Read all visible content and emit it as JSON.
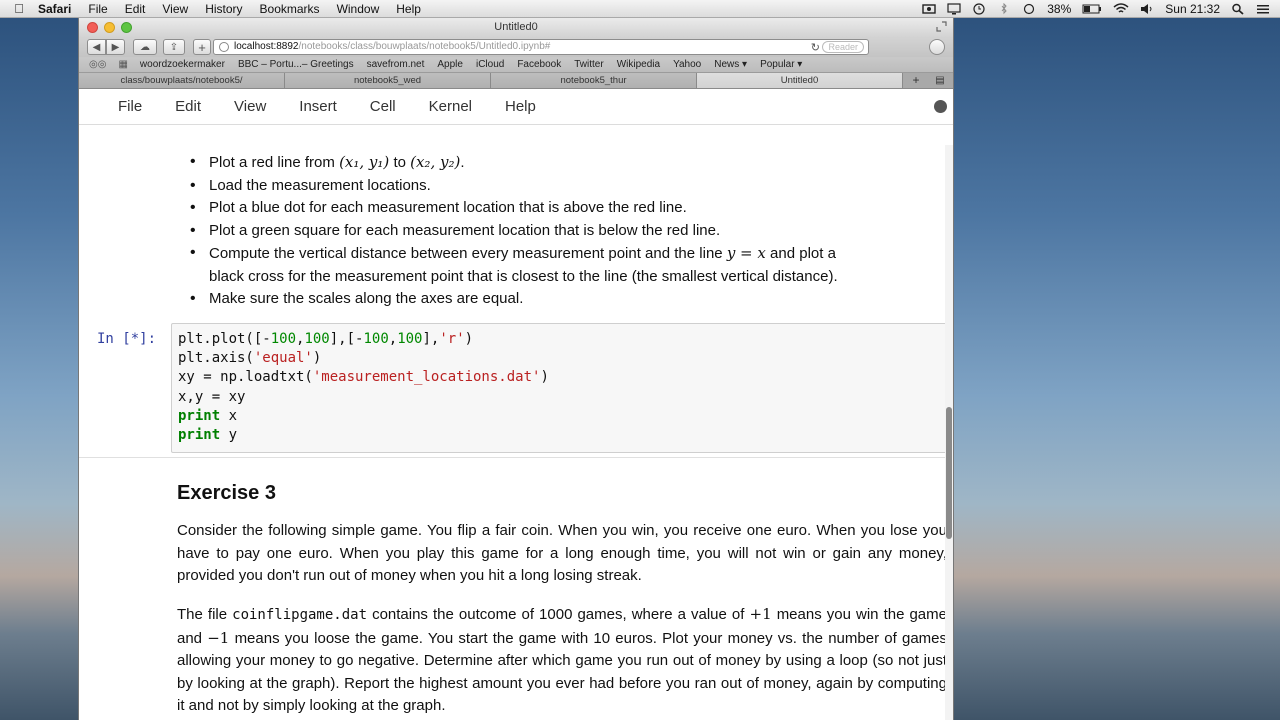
{
  "menubar": {
    "app": "Safari",
    "items": [
      "File",
      "Edit",
      "View",
      "History",
      "Bookmarks",
      "Window",
      "Help"
    ],
    "battery": "38%",
    "clock": "Sun 21:32"
  },
  "window": {
    "title": "Untitled0"
  },
  "toolbar": {
    "url_host": "localhost:8892",
    "url_path": "/notebooks/class/bouwplaats/notebook5/Untitled0.ipynb#",
    "reader": "Reader"
  },
  "bookmarks": [
    "woordzoekermaker",
    "BBC – Portu...– Greetings",
    "savefrom.net",
    "Apple",
    "iCloud",
    "Facebook",
    "Twitter",
    "Wikipedia",
    "Yahoo",
    "News ▾",
    "Popular ▾"
  ],
  "tabs": [
    "class/bouwplaats/notebook5/",
    "notebook5_wed",
    "notebook5_thur",
    "Untitled0"
  ],
  "jupyter_menu": [
    "File",
    "Edit",
    "View",
    "Insert",
    "Cell",
    "Kernel",
    "Help"
  ],
  "markdown1": {
    "b1_pre": "Plot a red line from",
    "b1_m1": "(x₁, y₁)",
    "b1_mid": "to",
    "b1_m2": "(x₂, y₂)",
    "b1_end": ".",
    "b2": "Load the measurement locations.",
    "b3": "Plot a blue dot for each measurement location that is above the red line.",
    "b4": "Plot a green square for each measurement location that is below the red line.",
    "b5_pre": "Compute the vertical distance between every measurement point and the line",
    "b5_math": "y = x",
    "b5_post": "and plot a",
    "b5_line2": "black cross for the measurement point that is closest to the line (the smallest vertical distance).",
    "b6": "Make sure the scales along the axes are equal."
  },
  "code_cell": {
    "prompt": "In [*]:",
    "l1_a": "plt.plot([-",
    "l1_n1": "100",
    "l1_b": ",",
    "l1_n2": "100",
    "l1_c": "],[-",
    "l1_n3": "100",
    "l1_d": ",",
    "l1_n4": "100",
    "l1_e": "],",
    "l1_s": "'r'",
    "l1_f": ")",
    "l2_a": "plt.axis(",
    "l2_s": "'equal'",
    "l2_b": ")",
    "l3_a": "xy = np.loadtxt(",
    "l3_s": "'measurement_locations.dat'",
    "l3_b": ")",
    "l4": "x,y = xy",
    "l5_kw": "print",
    "l5_v": " x",
    "l6_kw": "print",
    "l6_v": " y"
  },
  "exercise": {
    "title": "Exercise 3",
    "p1": "Consider the following simple game. You flip a fair coin. When you win, you receive one euro. When you lose you have to pay one euro. When you play this game for a long enough time, you will not win or gain any money, provided you don't run out of money when you hit a long losing streak.",
    "p2_a": "The file",
    "p2_file": "coinflipgame.dat",
    "p2_b": "contains the outcome of 1000 games, where a value of",
    "p2_plus": "+1",
    "p2_c": "means you win the game and",
    "p2_minus": "−1",
    "p2_d": "means you loose the game. You start the game with 10 euros. Plot your money vs. the number of games allowing your money to go negative. Determine after which game you run out of money by using a loop (so not just by looking at the graph). Report the highest amount you ever had before you ran out of money, again by computing it and not by simply looking at the graph."
  }
}
